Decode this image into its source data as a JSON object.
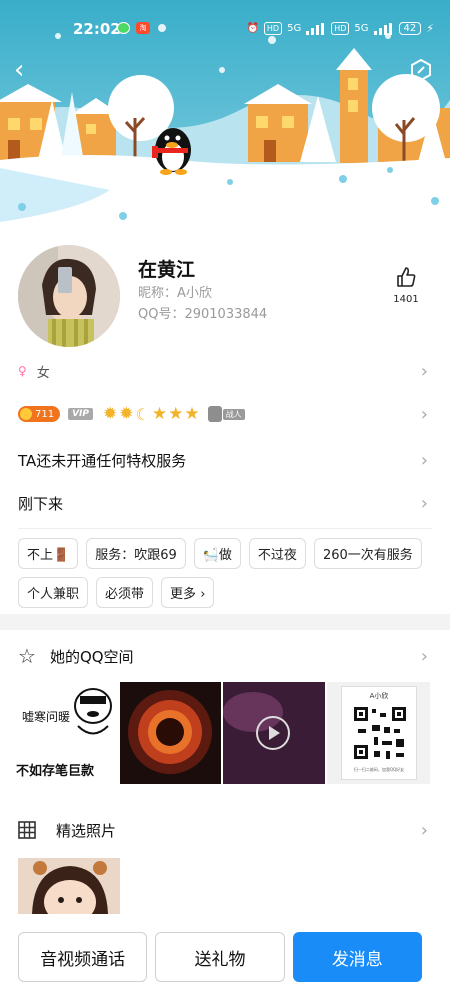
{
  "status_bar": {
    "time": "22:02",
    "signal1": "5G",
    "signal2": "5G",
    "hd1": "HD",
    "hd2": "HD",
    "battery": "42"
  },
  "profile": {
    "name": "在黄江",
    "nickname_label": "昵称：",
    "nickname": "A小欣",
    "qq_label": "QQ号：",
    "qq_number": "2901033844",
    "likes": "1401",
    "gender": "女"
  },
  "badges": {
    "level_number": "711",
    "vip_label": "VIP",
    "side_badge": "战人"
  },
  "rows": {
    "privilege": "TA还未开通任何特权服务",
    "status": "刚下来"
  },
  "tags": [
    "不上🚪",
    "服务：吹跟69",
    "🛀做",
    "不过夜",
    "260一次有服务",
    "个人兼职",
    "必须带",
    "更多"
  ],
  "qzone": {
    "title": "她的QQ空间",
    "meme_top": "嘘寒问暖",
    "meme_bottom": "不如存笔巨款",
    "qr_name": "A小欣",
    "qr_caption": "扫一扫二维码，加我QQ好友"
  },
  "photos": {
    "title": "精选照片"
  },
  "actions": {
    "call": "音视频通话",
    "gift": "送礼物",
    "message": "发消息"
  },
  "colors": {
    "primary": "#1a8cf7",
    "sky": "#4fb5d8",
    "coin": "#f0731e"
  }
}
